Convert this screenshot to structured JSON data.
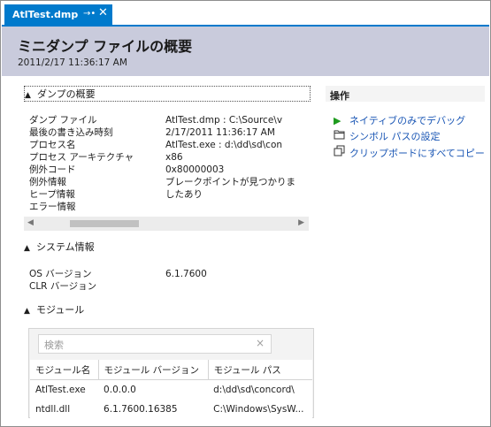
{
  "tab": {
    "title": "AtlTest.dmp",
    "pin_glyph": "→•",
    "close_glyph": "✕"
  },
  "header": {
    "title": "ミニダンプ ファイルの概要",
    "date": "2011/2/17 11:36:17 AM"
  },
  "dump_summary": {
    "heading": "ダンプの概要",
    "labels": [
      "ダンプ ファイル",
      "最後の書き込み時刻",
      "プロセス名",
      "プロセス アーキテクチャ",
      "例外コード",
      "例外情報",
      "ヒープ情報",
      "エラー情報"
    ],
    "values": [
      "AtlTest.dmp : C:\\Source\\v",
      "2/17/2011 11:36:17 AM",
      "AtlTest.exe : d:\\dd\\sd\\con",
      "x86",
      "0x80000003",
      "ブレークポイントが見つかりま",
      "したあり"
    ]
  },
  "system_info": {
    "heading": "システム情報",
    "labels": [
      "OS バージョン",
      "CLR バージョン"
    ],
    "values": [
      "6.1.7600",
      ""
    ]
  },
  "modules": {
    "heading": "モジュール",
    "search_placeholder": "検索",
    "columns": [
      "モジュール名",
      "モジュール バージョン",
      "モジュール パス"
    ],
    "rows": [
      {
        "name": "AtlTest.exe",
        "version": "0.0.0.0",
        "path": "d:\\dd\\sd\\concord\\"
      },
      {
        "name": "ntdll.dll",
        "version": "6.1.7600.16385",
        "path": "C:\\Windows\\SysW..."
      }
    ]
  },
  "actions": {
    "heading": "操作",
    "items": [
      {
        "label": "ネイティブのみでデバッグ",
        "icon": "play-icon"
      },
      {
        "label": "シンボル パスの設定",
        "icon": "folder-icon"
      },
      {
        "label": "クリップボードにすべてコピー",
        "icon": "copy-icon"
      }
    ]
  },
  "colors": {
    "accent": "#007acc",
    "header_bg": "#c9cbdc",
    "link": "#1b57b5"
  }
}
